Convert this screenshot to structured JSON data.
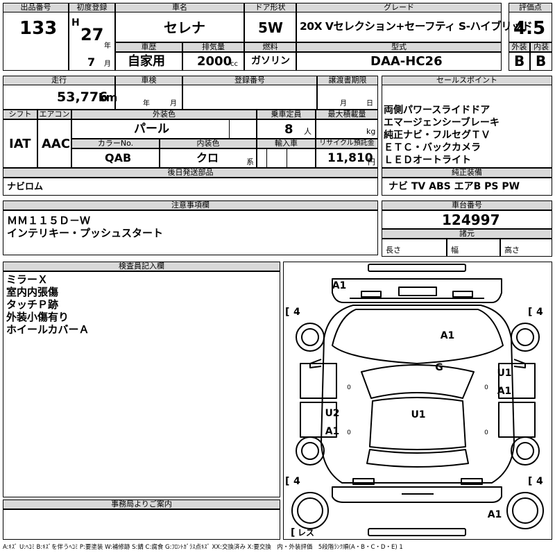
{
  "lot": {
    "label": "出品番号",
    "value": "133"
  },
  "first_reg": {
    "label": "初度登録",
    "era": "H",
    "year": "27",
    "year_unit": "年",
    "month": "7",
    "month_unit": "月"
  },
  "car_name": {
    "label": "車名",
    "value": "セレナ"
  },
  "door": {
    "label": "ドア形状",
    "value": "5W"
  },
  "grade": {
    "label": "グレード",
    "value": "20X Vセレクション+セーフティ S-ハイブリッド"
  },
  "score": {
    "label": "評価点",
    "value": "4.5",
    "ext_label": "外装",
    "int_label": "内装",
    "ext": "B",
    "int": "B"
  },
  "history": {
    "label": "車歴",
    "value": "自家用"
  },
  "displacement": {
    "label": "排気量",
    "value": "2000",
    "unit": "cc"
  },
  "fuel": {
    "label": "燃料",
    "value": "ガソリン"
  },
  "model": {
    "label": "型式",
    "value": "DAA-HC26"
  },
  "mileage": {
    "label": "走行",
    "value": "53,776",
    "unit": "km"
  },
  "inspection": {
    "label": "車検",
    "year_unit": "年",
    "month_unit": "月"
  },
  "reg_no": {
    "label": "登録番号"
  },
  "transfer": {
    "label": "譲渡書期限",
    "month_unit": "月",
    "day_unit": "日"
  },
  "sales_points": {
    "label": "セールスポイント",
    "lines": [
      "両側パワースライドドア",
      "エマージェンシーブレーキ",
      "純正ナビ・フルセグＴＶ",
      "ＥＴＣ・バックカメラ",
      "ＬＥＤオートライト"
    ]
  },
  "shift": {
    "label": "シフト",
    "value": "IAT"
  },
  "aircon": {
    "label": "エアコン",
    "value": "AAC"
  },
  "ext_color": {
    "label": "外装色",
    "value": "パール"
  },
  "capacity": {
    "label": "乗車定員",
    "value": "8",
    "unit": "人"
  },
  "max_load": {
    "label": "最大積載量",
    "unit": "kg"
  },
  "color_no": {
    "label": "カラーNo.",
    "value": "QAB"
  },
  "int_color": {
    "label": "内装色",
    "value": "クロ",
    "unit": "系"
  },
  "import": {
    "label": "輸入車"
  },
  "recycle": {
    "label": "リサイクル預託金",
    "value": "11,810",
    "unit": "円"
  },
  "later_parts": {
    "label": "後日発送部品",
    "value": "ナビロム"
  },
  "equipment": {
    "label": "純正装備",
    "value": "ナビ TV ABS エアB PS PW"
  },
  "notes": {
    "label": "注意事項欄",
    "lines": [
      "ＭＭ１１５Ｄ－Ｗ",
      "インテリキー・プッシュスタート"
    ]
  },
  "chassis": {
    "label": "車台番号",
    "value": "124997"
  },
  "dims": {
    "label": "諸元",
    "length": "長さ",
    "width": "幅",
    "height": "高さ"
  },
  "inspector": {
    "label": "検査員記入欄",
    "lines": [
      "ミラーＸ",
      "室内内張傷",
      "タッチＰ跡",
      "外装小傷有り",
      "ホイールカバーＡ"
    ]
  },
  "office": {
    "label": "事務局よりご案内"
  },
  "legend": "A:ｷｽﾞ U:ﾍｺﾐ B:ｷｽﾞを伴うﾍｺﾐ P:要塗装 W:補修跡 S:錆 C:腐食 G:ﾌﾛﾝﾄｶﾞﾗｽ点ｷｽﾞ XX:交換済み X:要交換　内・外装評価　5段階ﾗﾝｸ順(A・B・C・D・E) 1",
  "diagram": {
    "marks": {
      "a1_front": "A1",
      "a1_bonnet": "A1",
      "g": "G",
      "u1_right": "U1",
      "a1_right": "A1",
      "u2_left": "U2",
      "a1_left": "A1",
      "u1_roof": "U1",
      "a1_rear": "A1"
    },
    "tires": {
      "fl": "4",
      "fr": "4",
      "rl": "4",
      "rr": "4"
    },
    "spare": "レス",
    "zero": "0"
  }
}
